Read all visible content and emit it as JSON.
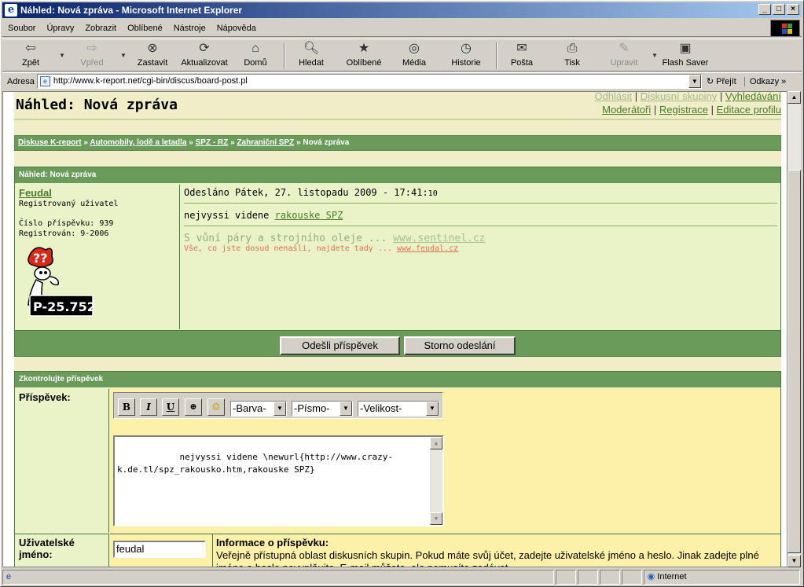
{
  "window": {
    "title": "Náhled: Nová zpráva - Microsoft Internet Explorer"
  },
  "menu": [
    "Soubor",
    "Úpravy",
    "Zobrazit",
    "Oblíbené",
    "Nástroje",
    "Nápověda"
  ],
  "toolbar": {
    "back": "Zpět",
    "forward": "Vpřed",
    "stop": "Zastavit",
    "refresh": "Aktualizovat",
    "home": "Domů",
    "search": "Hledat",
    "favorites": "Oblíbené",
    "media": "Média",
    "history": "Historie",
    "mail": "Pošta",
    "print": "Tisk",
    "edit": "Upravit",
    "flash": "Flash Saver"
  },
  "address": {
    "label": "Adresa",
    "url": "http://www.k-report.net/cgi-bin/discus/board-post.pl",
    "go": "Přejít",
    "links": "Odkazy"
  },
  "page": {
    "title": "Náhled: Nová zpráva",
    "top_links": {
      "logout": "Odhlásit",
      "groups": "Diskusní skupiny",
      "search": "Vyhledávání",
      "moderators": "Moderátoři",
      "register": "Registrace",
      "profile": "Editace profilu"
    },
    "breadcrumb": {
      "b1": "Diskuse K-report",
      "b2": "Automobily, lodě a letadla",
      "b3": "SPZ - RZ",
      "b4": "Zahraniční SPZ",
      "b5": "Nová zpráva",
      "sep": "»"
    },
    "preview": {
      "header": "Náhled: Nová zpráva",
      "author": "Feudal",
      "role": "Registrovaný uživatel",
      "post_no": "Číslo příspěvku: 939",
      "registered": "Registrován: 9-2006",
      "plate": "P-25.752",
      "sent": "Odesláno Pátek, 27. listopadu 2009 - 17:41:",
      "sent_sec": "10",
      "body": "nejvyssi videne ",
      "link": "rakouske SPZ",
      "sig1": "S vůní páry a strojního oleje ... ",
      "sig1_link": "www.sentinel.cz",
      "sig2": "Vše, co jste dosud nenašli, najdete tady ... ",
      "sig2_link": "www.feudal.cz",
      "submit": "Odešli příspěvek",
      "cancel": "Storno odeslání"
    },
    "check": {
      "header": "Zkontrolujte příspěvek",
      "post_label": "Příspěvek:",
      "color": "-Barva-",
      "font": "-Písmo-",
      "size": "-Velikost-",
      "text": "nejvyssi videne \\newurl{http://www.crazy-k.de.tl/spz_rakousko.htm,rakouske SPZ}",
      "user_label": "Uživatelské jméno:",
      "user_value": "feudal",
      "info_title": "Informace o příspěvku:",
      "info_text": "Veřejně přístupná oblast diskusních skupin. Pokud máte svůj účet, zadejte uživatelské jméno a heslo. Jinak zadejte plné jméno a heslo nevyplňujte. E-mail můžete, ale nemusíte zadávat."
    }
  },
  "status": {
    "zone": "Internet"
  }
}
